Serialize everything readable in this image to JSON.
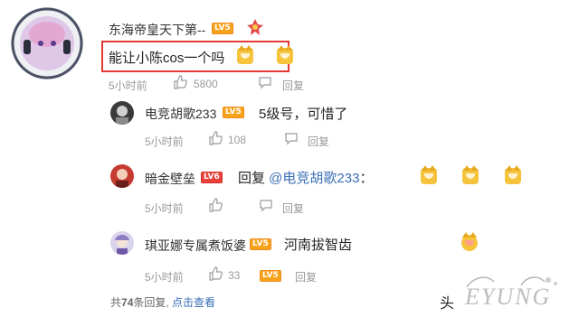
{
  "main_comment": {
    "username": "东海帝皇天下第--",
    "level": "LV5",
    "text": "能让小陈cos一个吗",
    "time": "5小时前",
    "likes": "5800",
    "reply_label": "回复"
  },
  "replies": [
    {
      "username": "电竞胡歌233",
      "level": "LV5",
      "text": "5级号，可惜了",
      "time": "5小时前",
      "likes": "108",
      "reply_label": "回复"
    },
    {
      "username": "暗金壁垒",
      "level": "LV6",
      "text_prefix": "回复 ",
      "mention": "@电竞胡歌233",
      "text_suffix": "：",
      "time": "5小时前",
      "likes": "",
      "reply_label": "回复"
    },
    {
      "username": "琪亚娜专属煮饭婆",
      "level": "LV5",
      "text": "河南拔智齿",
      "time": "5小时前",
      "likes": "33",
      "reply_label": "回复"
    }
  ],
  "footer": {
    "total_prefix": "共",
    "total_count": "74",
    "total_suffix": "条回复, ",
    "view_link": "点击查看"
  },
  "watermark": {
    "left_text": "头",
    "brand": "EYUNG"
  },
  "colors": {
    "highlight": "#e53935",
    "mention": "#3a6fb6",
    "badge_orange": "#f7a21b",
    "badge_red": "#e8403b",
    "meta": "#999999"
  }
}
